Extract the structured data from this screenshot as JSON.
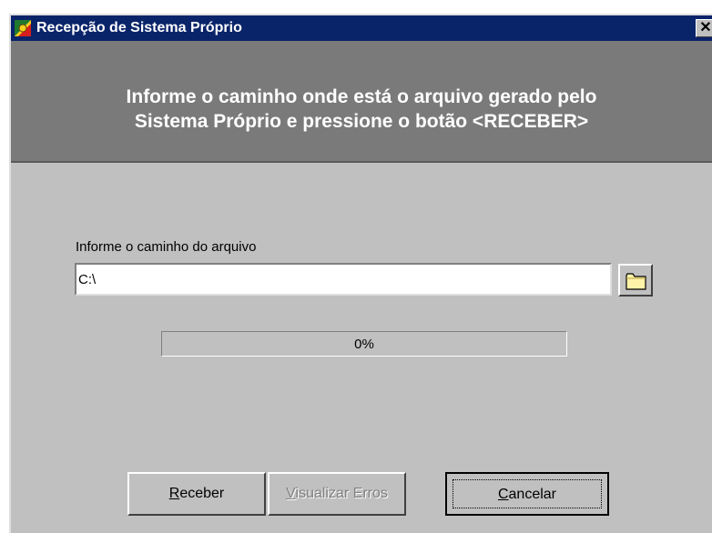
{
  "window": {
    "title": "Recepção de Sistema Próprio",
    "close_glyph": "✕"
  },
  "banner": {
    "line1": "Informe o caminho onde está  o  arquivo  gerado pelo",
    "line2": "Sistema Próprio e pressione o botão  <RECEBER>"
  },
  "form": {
    "path_label": "Informe o caminho do arquivo",
    "path_value": "C:\\",
    "browse_icon": "folder-icon"
  },
  "progress": {
    "percent": 0,
    "text": "0%"
  },
  "buttons": {
    "receber": {
      "accel": "R",
      "rest": "eceber"
    },
    "visualizar": {
      "accel": "V",
      "rest": "isualizar Erros"
    },
    "cancelar": {
      "accel": "C",
      "rest": "ancelar"
    }
  },
  "colors": {
    "titlebar": "#0a246a",
    "banner": "#7a7a7a",
    "face": "#c0c0c0"
  }
}
